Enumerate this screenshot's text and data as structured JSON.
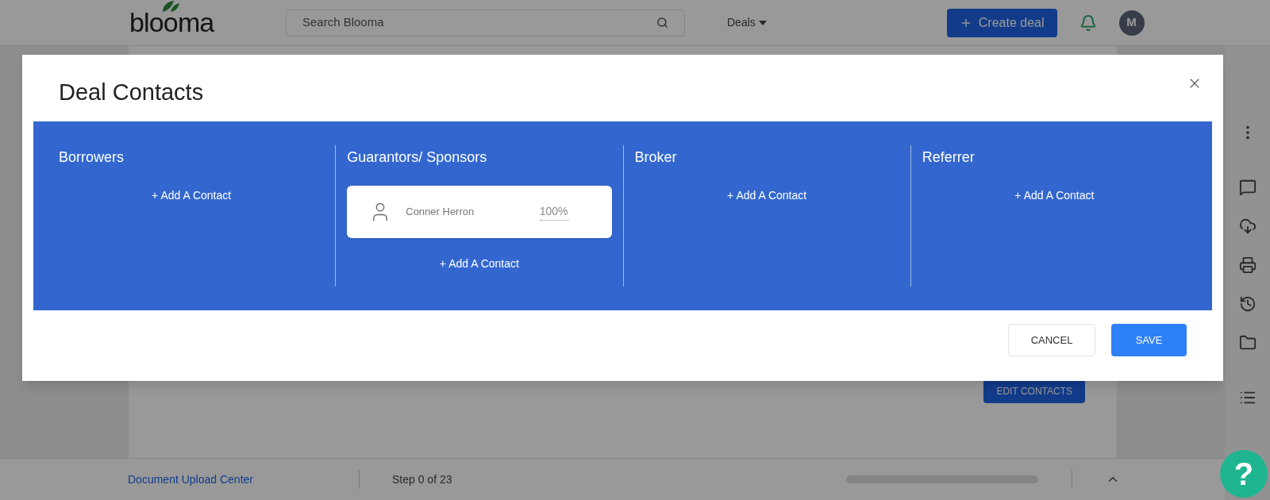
{
  "header": {
    "logo": "blooma",
    "search": {
      "placeholder": "Search Blooma"
    },
    "nav": "Deals",
    "create_button": "Create deal",
    "avatar": "M"
  },
  "page": {
    "edit_button": "EDIT CONTACTS"
  },
  "footer": {
    "link": "Document Upload Center",
    "step": "Step 0 of 23"
  },
  "help_button": "?",
  "modal": {
    "title": "Deal Contacts",
    "sections": [
      {
        "title": "Borrowers",
        "add_label": "+ Add A Contact"
      },
      {
        "title": "Guarantors/ Sponsors",
        "contacts": [
          {
            "name": "Conner Herron",
            "share": "100%"
          }
        ],
        "add_label": "+ Add A Contact"
      },
      {
        "title": "Broker",
        "add_label": "+ Add A Contact"
      },
      {
        "title": "Referrer",
        "add_label": "+ Add A Contact"
      }
    ],
    "buttons": [
      {
        "label": "CANCEL",
        "kind": "secondary"
      },
      {
        "label": "SAVE",
        "kind": "primary"
      }
    ]
  }
}
